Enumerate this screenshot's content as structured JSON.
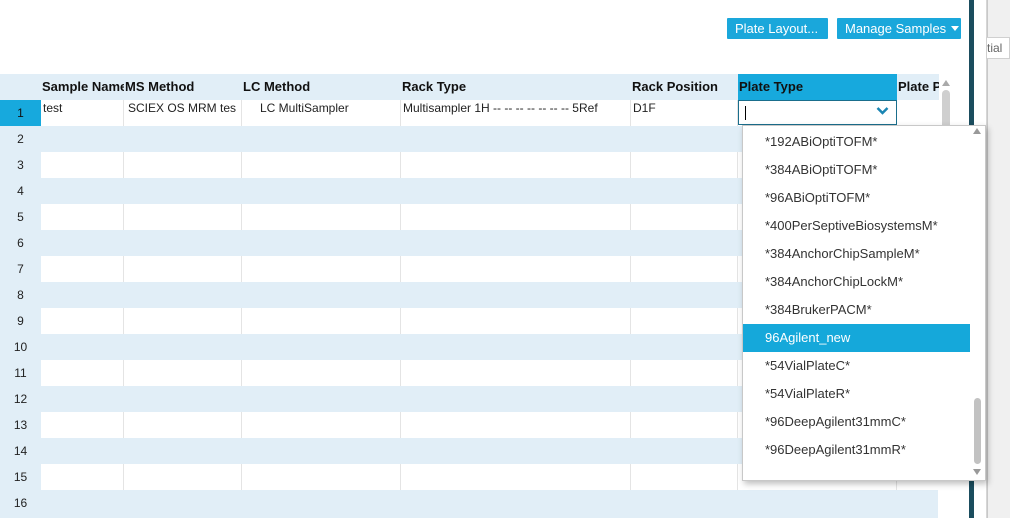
{
  "toolbar": {
    "plate_layout_label": "Plate Layout...",
    "manage_samples_label": "Manage Samples"
  },
  "right_pane": {
    "partial_text": "tial"
  },
  "columns": [
    "Sample Name",
    "MS Method",
    "LC Method",
    "Rack Type",
    "Rack Position",
    "Plate Type",
    "Plate Po"
  ],
  "row_numbers": [
    "1",
    "2",
    "3",
    "4",
    "5",
    "6",
    "7",
    "8",
    "9",
    "10",
    "11",
    "12",
    "13",
    "14",
    "15",
    "16"
  ],
  "row1": {
    "sample_name": "test",
    "ms_method": "SCIEX OS MRM tes",
    "lc_method": "LC MultiSampler",
    "rack_type": "Multisampler 1H -- -- -- -- -- -- -- 5Ref",
    "rack_position": "D1F",
    "plate_type": ""
  },
  "dropdown": {
    "options": [
      "*192ABiOptiTOFM*",
      "*384ABiOptiTOFM*",
      "*96ABiOptiTOFM*",
      "*400PerSeptiveBiosystemsM*",
      "*384AnchorChipSampleM*",
      "*384AnchorChipLockM*",
      "*384BrukerPACM*",
      "96Agilent_new",
      "*54VialPlateC*",
      "*54VialPlateR*",
      "*96DeepAgilent31mmC*",
      "*96DeepAgilent31mmR*"
    ],
    "selected": "96Agilent_new"
  },
  "colors": {
    "accent": "#17a9dd",
    "header_bg": "#e1eef7",
    "row_alt": "#e1eef7",
    "side_strip": "#1b4d5e"
  }
}
